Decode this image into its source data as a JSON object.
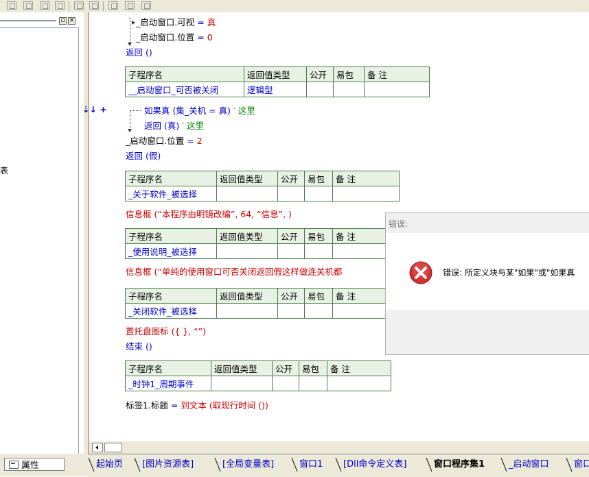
{
  "left_panel": {
    "strip_text": "表",
    "props_label": "属性"
  },
  "code": {
    "line1": "_启动窗口.可视",
    "line1_op": "=",
    "line1_val": "真",
    "line2": "_启动窗口.位置",
    "line2_op": "=",
    "line2_val": "0",
    "line3": "返回 ()",
    "table1": {
      "headers": [
        "子程序名",
        "返回值类型",
        "公开",
        "易包",
        "备 注"
      ],
      "row": [
        "__启动窗口_可否被关闭",
        "逻辑型",
        "",
        "",
        ""
      ]
    },
    "gutter_marker": "⇣↓ +",
    "if_line_kw": "如果真 (集_关机",
    "if_line_op": "=",
    "if_line_val": "真)",
    "if_line_comment": "′ 这里",
    "ret_true": "返回 (真)",
    "ret_true_comment": "′ 这里",
    "pos_line": "_启动窗口.位置",
    "pos_op": "=",
    "pos_val": "2",
    "ret_false": "返回 (假)",
    "table2": {
      "headers": [
        "子程序名",
        "返回值类型",
        "公开",
        "易包",
        "备 注"
      ],
      "row": [
        "_关于软件_被选择",
        "",
        "",
        "",
        ""
      ]
    },
    "msg1_kw": "信息框",
    "msg1_args": "(“本程序由明镜改编”, 64, “信息”, )",
    "table3": {
      "headers": [
        "子程序名",
        "返回值类型",
        "公开",
        "易包",
        "备 注"
      ],
      "row": [
        "_使用说明_被选择",
        "",
        "",
        "",
        ""
      ]
    },
    "msg2_kw": "信息框",
    "msg2_args": "(“单纯的使用窗口可否关闭返回假这样做连关机都",
    "table4": {
      "headers": [
        "子程序名",
        "返回值类型",
        "公开",
        "易包",
        "备 注"
      ],
      "row": [
        "_关闭软件_被选择",
        "",
        "",
        "",
        ""
      ]
    },
    "tray_line": "置托盘图标 ({ }, “”)",
    "end_line": "结束 ()",
    "table5": {
      "headers": [
        "子程序名",
        "返回值类型",
        "公开",
        "易包",
        "备 注"
      ],
      "row": [
        "_时钟1_周期事件",
        "",
        "",
        "",
        ""
      ]
    },
    "label_line_obj": "标签1.标题",
    "label_line_op": "=",
    "label_line_func": "到文本 (取现行时间 ())"
  },
  "dialog": {
    "title": "错误:",
    "message": "错误: 所定义块与某\"如果\"或\"如果真"
  },
  "tabs": [
    {
      "label": "起始页",
      "active": false
    },
    {
      "label": "[图片资源表]",
      "active": false
    },
    {
      "label": "[全局变量表]",
      "active": false
    },
    {
      "label": "窗口1",
      "active": false
    },
    {
      "label": "[Dll命令定义表]",
      "active": false
    },
    {
      "label": "窗口程序集1",
      "active": true
    },
    {
      "label": "_启动窗口",
      "active": false
    },
    {
      "label": "窗口",
      "active": false
    }
  ],
  "colors": {
    "keyword_blue": "#0000cc",
    "value_red": "#cc0000",
    "comment_green": "#008000",
    "table_border": "#4a7a4a",
    "error_red": "#d32f2f"
  }
}
